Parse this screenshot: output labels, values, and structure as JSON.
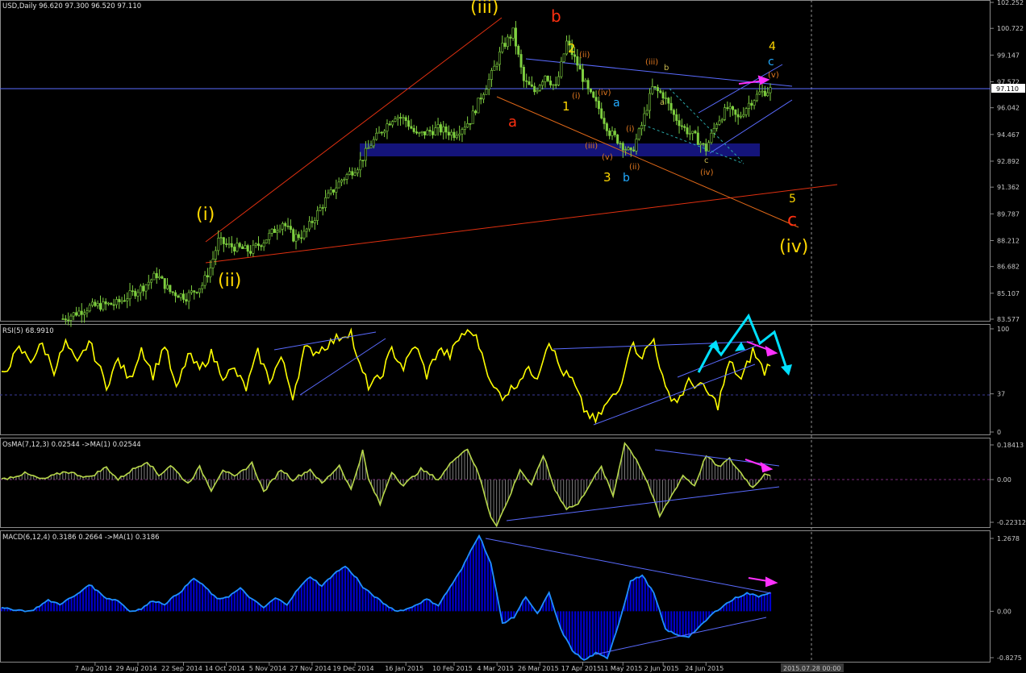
{
  "window": {
    "main_header": "USD,Daily  96.620 97.300 96.520 97.110",
    "rsi_header": "RSI(5) 68.9910",
    "osma_header": "OsMA(7,12,3) 0.02544  ->MA(1) 0.02544",
    "macd_header": "MACD(6,12,4) 0.3186 0.2664  ->MA(1) 0.3186",
    "time_marker": "2015.07.28 00:00"
  },
  "colors": {
    "background": "#000000",
    "candles": "#7fd040",
    "rsi_line": "#ffff00",
    "osma": "#b8d84a",
    "macd": "#1e90ff",
    "macd_fill": "#0000cc",
    "trend_red": "#e03010",
    "trend_blue": "#5a6bff",
    "support_zone": "#14147a",
    "annotation_cyan": "#00e0ff",
    "annotation_magenta": "#ff30ff"
  },
  "chart_data": [
    {
      "type": "candlestick",
      "title": "USD,Daily",
      "ohlc_last": {
        "open": 96.62,
        "high": 97.3,
        "low": 96.52,
        "close": 97.11
      },
      "y_ticks": [
        "102.252",
        "100.722",
        "99.147",
        "97.572",
        "96.042",
        "94.467",
        "92.892",
        "91.362",
        "89.787",
        "88.212",
        "86.682",
        "85.107",
        "83.577"
      ],
      "ylim": [
        83.577,
        102.252
      ],
      "current_price_label": "97.110",
      "x_ticks": [
        "7 Aug 2014",
        "29 Aug 2014",
        "22 Sep 2014",
        "14 Oct 2014",
        "5 Nov 2014",
        "27 Nov 2014",
        "19 Dec 2014",
        "16 Jan 2015",
        "10 Feb 2015",
        "4 Mar 2015",
        "26 Mar 2015",
        "17 Apr 2015",
        "11 May 2015",
        "2 Jun 2015",
        "24 Jun 2015"
      ],
      "series": {
        "x": [
          "7 Aug 2014",
          "29 Aug 2014",
          "22 Sep 2014",
          "14 Oct 2014",
          "5 Nov 2014",
          "27 Nov 2014",
          "19 Dec 2014",
          "16 Jan 2015",
          "10 Feb 2015",
          "4 Mar 2015",
          "13 Mar 2015",
          "26 Mar 2015",
          "13 Apr 2015",
          "17 Apr 2015",
          "24 Apr 2015",
          "11 May 2015",
          "15 May 2015",
          "27 May 2015",
          "2 Jun 2015",
          "10 Jun 2015",
          "24 Jun 2015",
          "28 Jul 2015"
        ],
        "close": [
          81.6,
          84.2,
          85.6,
          85.3,
          87.4,
          88.0,
          89.7,
          93.0,
          94.4,
          95.8,
          100.3,
          97.6,
          99.8,
          97.5,
          96.6,
          93.2,
          94.6,
          97.3,
          96.6,
          94.2,
          95.9,
          97.11
        ]
      },
      "wave_labels": [
        {
          "text": "(i)",
          "color": "#ffd700"
        },
        {
          "text": "(ii)",
          "color": "#ffd700"
        },
        {
          "text": "(iii)",
          "color": "#ffd700"
        },
        {
          "text": "(iv)",
          "color": "#ffd700"
        },
        {
          "text": "a",
          "color": "#ff3010"
        },
        {
          "text": "b",
          "color": "#ff3010"
        },
        {
          "text": "c",
          "color": "#ff3010"
        },
        {
          "text": "1",
          "color": "#ffd700"
        },
        {
          "text": "2",
          "color": "#ffd700"
        },
        {
          "text": "3",
          "color": "#ffd700"
        },
        {
          "text": "4",
          "color": "#ffd700"
        },
        {
          "text": "5",
          "color": "#ffd700"
        },
        {
          "text": "a",
          "color": "#22aaff"
        },
        {
          "text": "b",
          "color": "#22aaff"
        },
        {
          "text": "c",
          "color": "#22aaff"
        },
        {
          "text": "(i)",
          "color": "#e07820"
        },
        {
          "text": "(ii)",
          "color": "#e07820"
        },
        {
          "text": "(iii)",
          "color": "#e07820"
        },
        {
          "text": "(iv)",
          "color": "#e07820"
        },
        {
          "text": "(v)",
          "color": "#e07820"
        },
        {
          "text": "a",
          "color": "#c8b850"
        },
        {
          "text": "b",
          "color": "#c8b850"
        },
        {
          "text": "c",
          "color": "#c8b850"
        }
      ]
    },
    {
      "type": "line",
      "title": "RSI(5) 68.9910",
      "y_ticks": [
        "100",
        "37",
        "0"
      ],
      "ylim": [
        0,
        100
      ],
      "level": 37,
      "last_value": 68.991
    },
    {
      "type": "bar",
      "title": "OsMA(7,12,3) 0.02544  ->MA(1) 0.02544",
      "y_ticks": [
        "0.18413",
        "0.00",
        "-0.22312"
      ],
      "ylim": [
        -0.22312,
        0.18413
      ],
      "last_value": 0.02544
    },
    {
      "type": "area",
      "title": "MACD(6,12,4) 0.3186 0.2664  ->MA(1) 0.3186",
      "y_ticks": [
        "1.2678",
        "0.00",
        "-0.8275"
      ],
      "ylim": [
        -0.8275,
        1.2678
      ],
      "last_value": 0.3186
    }
  ]
}
